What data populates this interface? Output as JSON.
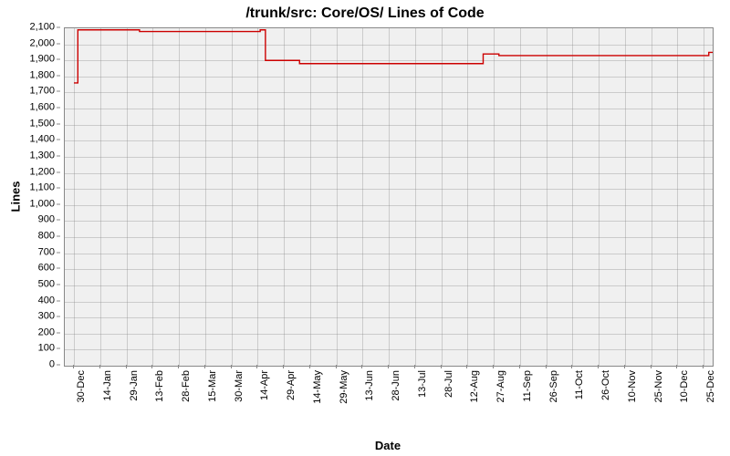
{
  "chart_data": {
    "type": "line",
    "title": "/trunk/src: Core/OS/ Lines of Code",
    "xlabel": "Date",
    "ylabel": "Lines",
    "ylim": [
      0,
      2100
    ],
    "y_ticks": [
      0,
      100,
      200,
      300,
      400,
      500,
      600,
      700,
      800,
      900,
      1000,
      1100,
      1200,
      1300,
      1400,
      1500,
      1600,
      1700,
      1800,
      1900,
      2000,
      2100
    ],
    "y_tick_labels": [
      "0",
      "100",
      "200",
      "300",
      "400",
      "500",
      "600",
      "700",
      "800",
      "900",
      "1,000",
      "1,100",
      "1,200",
      "1,300",
      "1,400",
      "1,500",
      "1,600",
      "1,700",
      "1,800",
      "1,900",
      "2,000",
      "2,100"
    ],
    "categories": [
      "30-Dec",
      "14-Jan",
      "29-Jan",
      "13-Feb",
      "28-Feb",
      "15-Mar",
      "30-Mar",
      "14-Apr",
      "29-Apr",
      "14-May",
      "29-May",
      "13-Jun",
      "28-Jun",
      "13-Jul",
      "28-Jul",
      "12-Aug",
      "27-Aug",
      "11-Sep",
      "26-Sep",
      "11-Oct",
      "26-Oct",
      "10-Nov",
      "25-Nov",
      "10-Dec",
      "25-Dec"
    ],
    "series": [
      {
        "name": "Core/OS/",
        "points": [
          {
            "x": 0.0,
            "y": 1760
          },
          {
            "x": 0.15,
            "y": 1760
          },
          {
            "x": 0.15,
            "y": 2090
          },
          {
            "x": 2.5,
            "y": 2090
          },
          {
            "x": 2.5,
            "y": 2080
          },
          {
            "x": 7.1,
            "y": 2080
          },
          {
            "x": 7.1,
            "y": 2090
          },
          {
            "x": 7.3,
            "y": 2090
          },
          {
            "x": 7.3,
            "y": 1900
          },
          {
            "x": 8.6,
            "y": 1900
          },
          {
            "x": 8.6,
            "y": 1880
          },
          {
            "x": 15.6,
            "y": 1880
          },
          {
            "x": 15.6,
            "y": 1940
          },
          {
            "x": 16.2,
            "y": 1940
          },
          {
            "x": 16.2,
            "y": 1930
          },
          {
            "x": 24.2,
            "y": 1930
          },
          {
            "x": 24.2,
            "y": 1950
          },
          {
            "x": 25.0,
            "y": 1950
          }
        ]
      }
    ]
  }
}
